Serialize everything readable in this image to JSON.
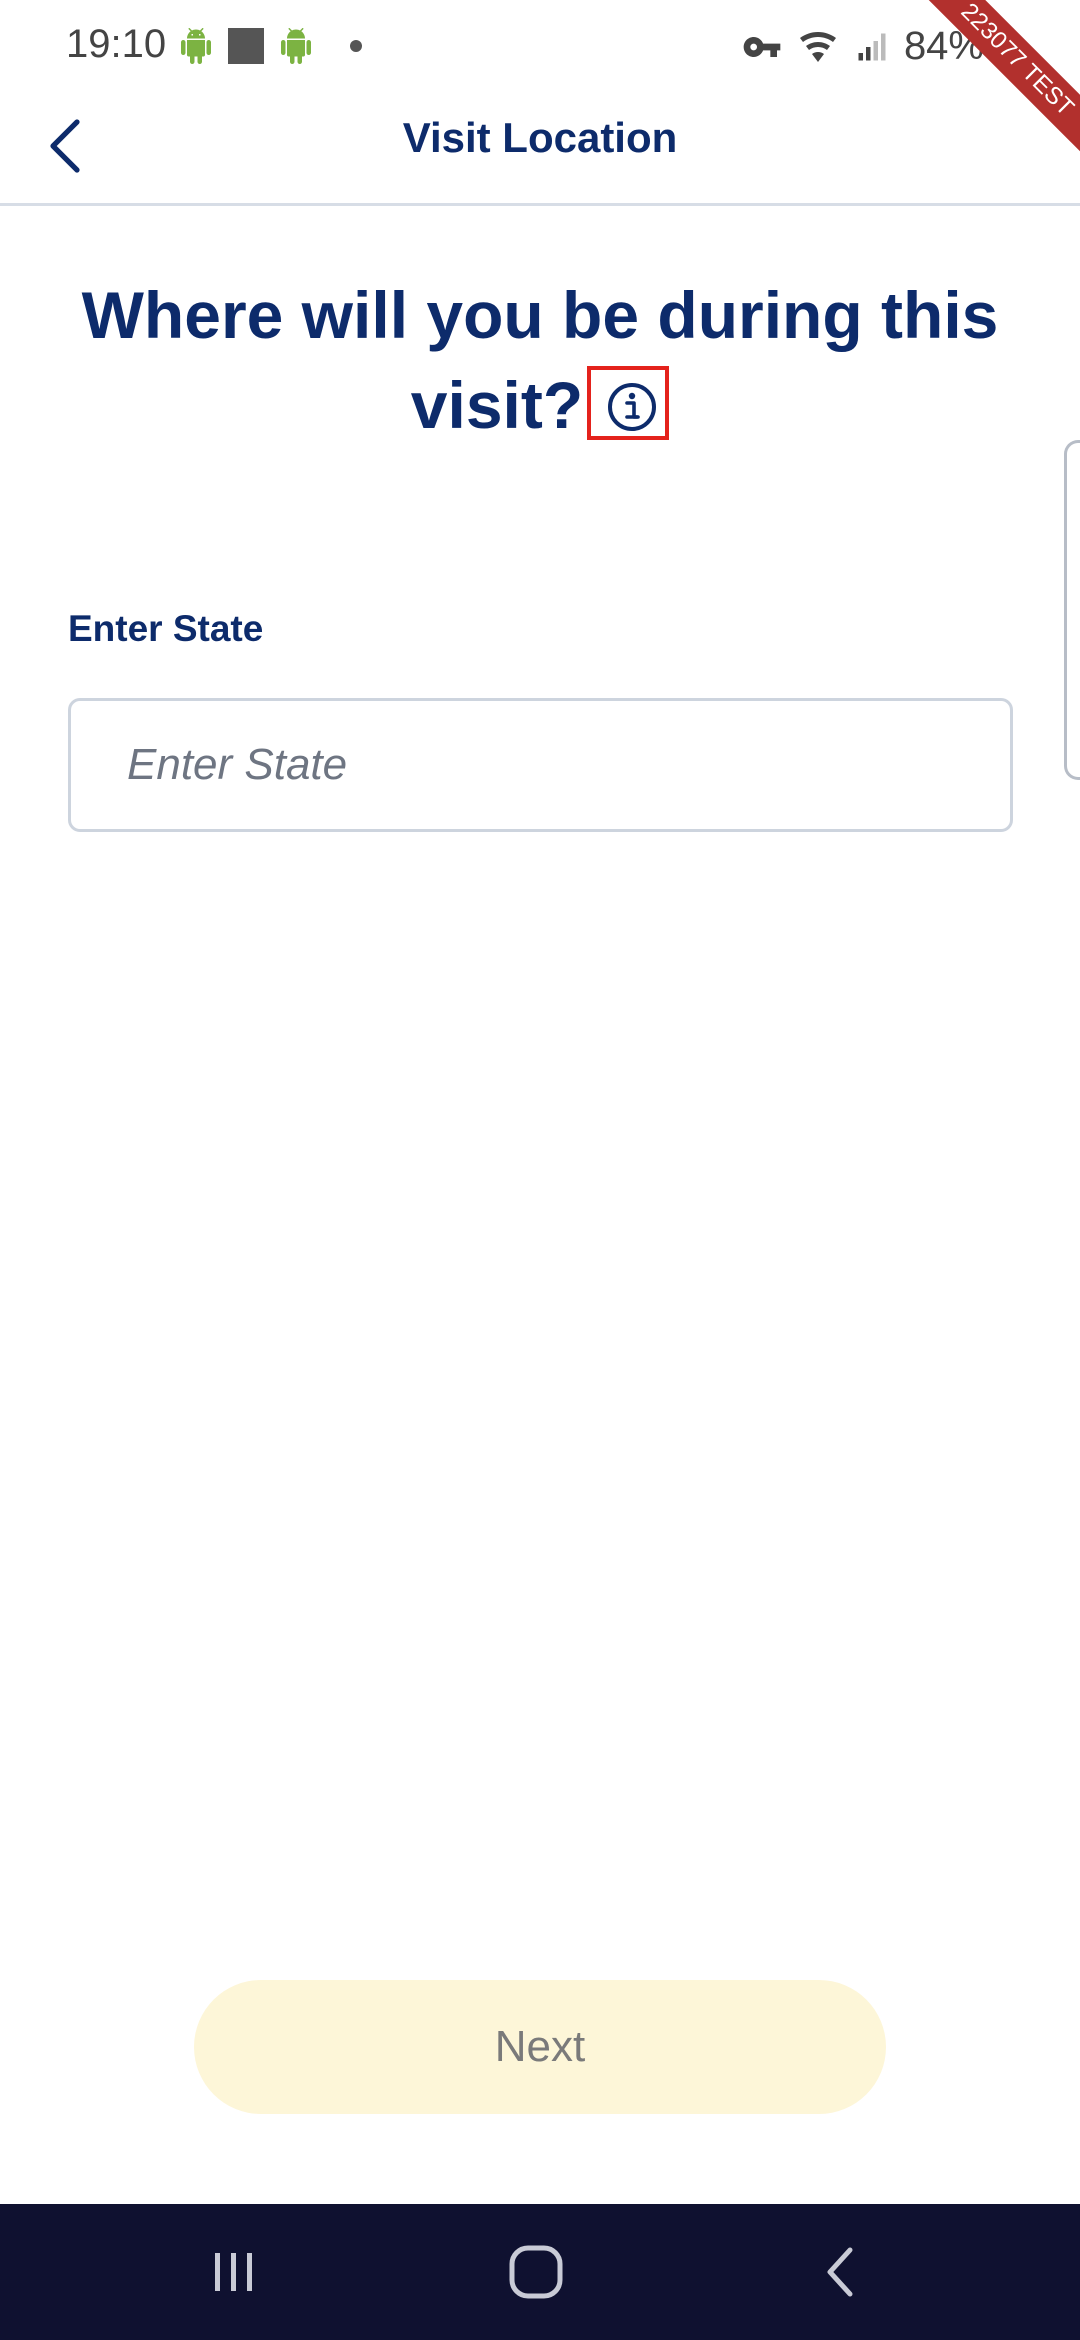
{
  "status_bar": {
    "time": "19:10",
    "battery": "84%",
    "icons_left": [
      "android-icon",
      "square-icon",
      "android-icon",
      "dot-icon"
    ],
    "icons_right": [
      "key-icon",
      "wifi-icon",
      "signal-icon",
      "battery-icon"
    ]
  },
  "debug_ribbon": "223077 TEST",
  "app_bar": {
    "title": "Visit Location",
    "back_icon": "chevron-left-icon"
  },
  "main": {
    "headline": "Where will you be during this visit?",
    "info_icon": "info-icon",
    "state_field": {
      "label": "Enter State",
      "placeholder": "Enter State",
      "value": ""
    },
    "next_label": "Next"
  },
  "nav_bar": {
    "items": [
      "recent-apps-icon",
      "home-icon",
      "back-icon"
    ]
  },
  "colors": {
    "primary": "#0d2b6b",
    "button_disabled_bg": "#fdf6d8",
    "nav_bg": "#0f1130",
    "ribbon": "#b2302d"
  }
}
